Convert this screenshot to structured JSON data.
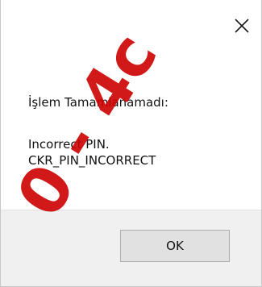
{
  "dialog": {
    "heading": "İşlem Tamamlanamadı:",
    "message_lines": [
      "Incorrect PIN.",
      "CKR_PIN_INCORRECT"
    ],
    "ok_label": "OK"
  },
  "watermark": {
    "text": "0 - 4c",
    "color": "#cc0000"
  },
  "icons": {
    "close": "close-icon"
  },
  "colors": {
    "footer_bg": "#f0f0f0",
    "button_bg": "#e1e1e1",
    "button_border": "#adadad"
  }
}
